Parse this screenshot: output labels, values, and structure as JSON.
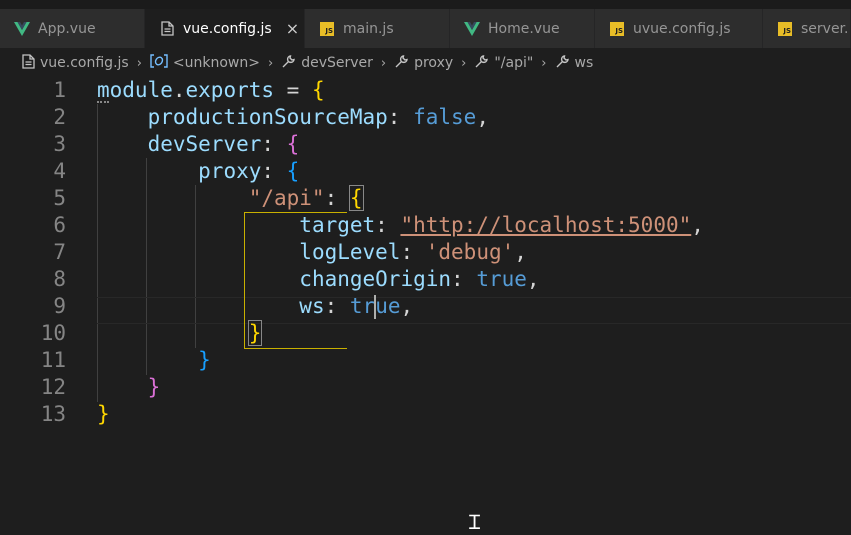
{
  "tabs": [
    {
      "label": "App.vue",
      "icon": "vue-icon",
      "active": false
    },
    {
      "label": "vue.config.js",
      "icon": "file-icon",
      "active": true,
      "close": "×"
    },
    {
      "label": "main.js",
      "icon": "js-icon",
      "active": false
    },
    {
      "label": "Home.vue",
      "icon": "vue-icon",
      "active": false
    },
    {
      "label": "uvue.config.js",
      "icon": "js-icon",
      "active": false
    },
    {
      "label": "server.",
      "icon": "js-icon",
      "active": false
    }
  ],
  "js_badge": "JS",
  "breadcrumbs": [
    {
      "label": "vue.config.js",
      "icon": "file-icon"
    },
    {
      "label": "<unknown>",
      "icon": "module-icon"
    },
    {
      "label": "devServer",
      "icon": "wrench-icon"
    },
    {
      "label": "proxy",
      "icon": "wrench-icon"
    },
    {
      "label": "\"/api\"",
      "icon": "wrench-icon"
    },
    {
      "label": "ws",
      "icon": "wrench-icon"
    }
  ],
  "editor": {
    "line_numbers": [
      "1",
      "2",
      "3",
      "4",
      "5",
      "6",
      "7",
      "8",
      "9",
      "10",
      "11",
      "12",
      "13"
    ],
    "tokens": {
      "module": "module",
      "dot": ".",
      "exports": "exports",
      "eq": " = ",
      "open1": "{",
      "productionSourceMap": "productionSourceMap",
      "colon": ": ",
      "false": "false",
      "comma": ",",
      "devServer": "devServer",
      "open2": "{",
      "proxy": "proxy",
      "open3": "{",
      "api": "\"/api\"",
      "colon_bare": ":",
      "space": " ",
      "open4": "{",
      "target": "target",
      "url": "\"http://localhost:5000\"",
      "logLevel": "logLevel",
      "debug": "'debug'",
      "changeOrigin": "changeOrigin",
      "true": "true",
      "ws": "ws",
      "tr": "tr",
      "ue": "ue",
      "close4": "}",
      "close3": "}",
      "close2": "}",
      "close1": "}"
    }
  },
  "colors": {
    "background": "#1e1e1e",
    "property": "#9cdcfe",
    "keyword": "#569cd6",
    "string": "#ce9178",
    "bracket1": "#ffd700",
    "bracket2": "#da70d6",
    "bracket3": "#179fff"
  }
}
